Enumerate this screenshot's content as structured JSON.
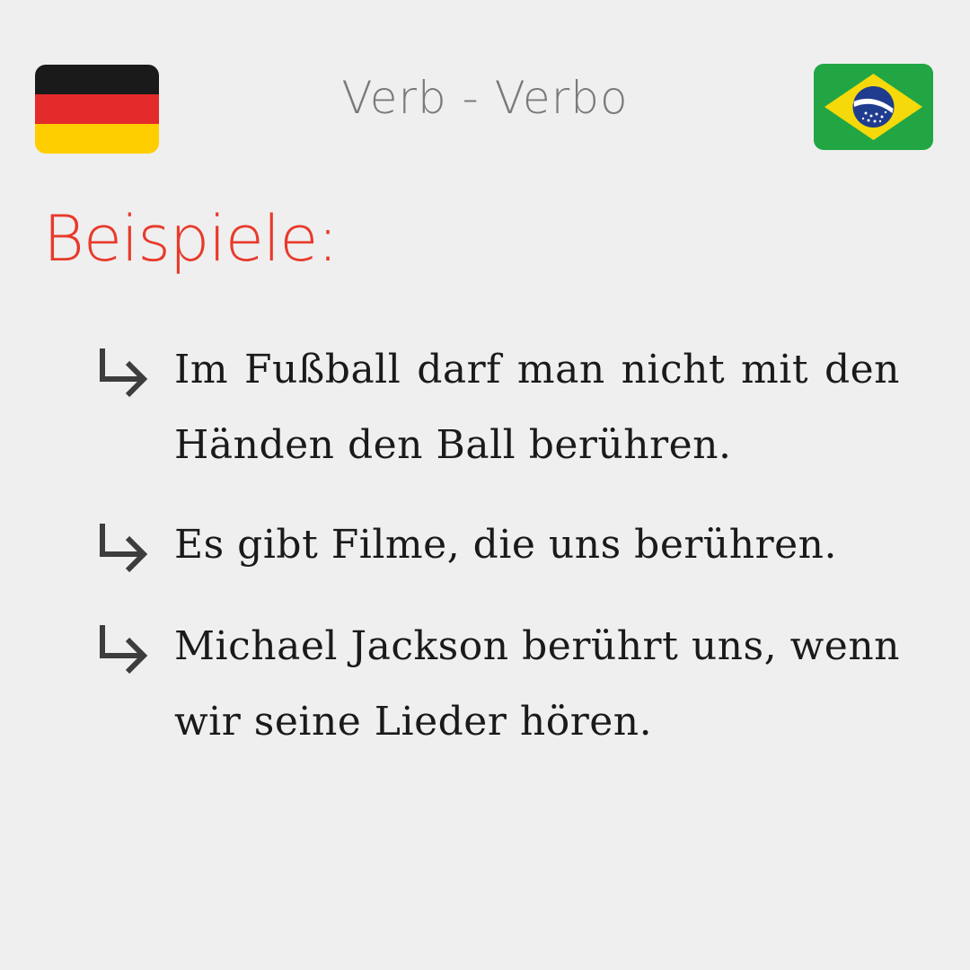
{
  "header": {
    "title": "Verb - Verbo",
    "title_color": "#7a7a7a",
    "left_flag": {
      "icon": "germany-flag-icon",
      "colors": [
        "#1a1a1a",
        "#e42b2b",
        "#ffce00"
      ]
    },
    "right_flag": {
      "icon": "brazil-flag-icon",
      "colors": [
        "#22a644",
        "#f5d90a",
        "#1f3c8f",
        "#ffffff"
      ]
    }
  },
  "section": {
    "title": "Beispiele:",
    "title_color": "#e83a2b"
  },
  "examples": [
    {
      "icon": "arrow-right-down-icon",
      "text": "Im Fußball darf man nicht mit den Händen den Ball berühren."
    },
    {
      "icon": "arrow-right-down-icon",
      "text": "Es gibt Filme, die uns berühren."
    },
    {
      "icon": "arrow-right-down-icon",
      "text": "Michael Jackson berührt uns, wenn wir seine Lieder hören."
    }
  ],
  "colors": {
    "background": "#efefef",
    "text": "#1a1a1a",
    "arrow": "#3d3d3d"
  }
}
